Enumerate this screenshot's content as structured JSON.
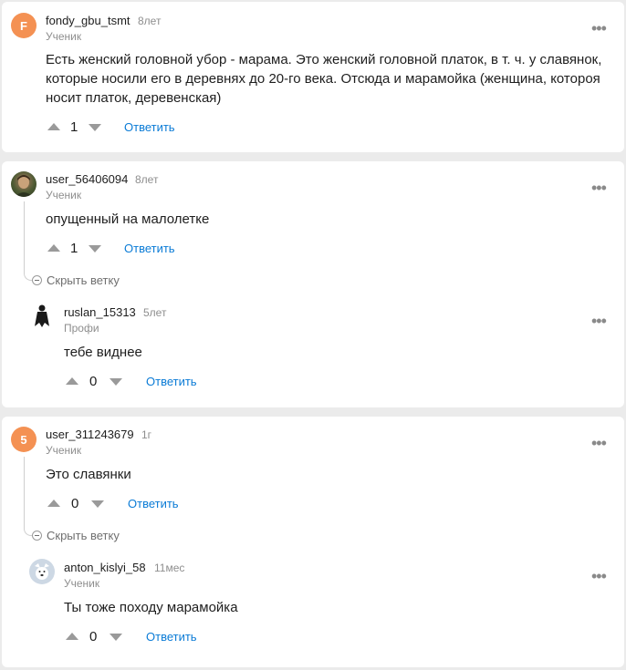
{
  "comments": [
    {
      "avatar_letter": "F",
      "username": "fondy_gbu_tsmt",
      "age": "8лет",
      "role": "Ученик",
      "lines": [
        "Есть женский головной убор - марама. Это женский головной платок, в т. ч. у славянок,",
        "которые носили его в деревнях до 20-го века. Отсюда и марамойка (женщина, котороя",
        "носит платок, деревенская)"
      ],
      "votes": "1",
      "reply_label": "Ответить"
    },
    {
      "username": "user_56406094",
      "age": "8лет",
      "role": "Ученик",
      "text": "опущенный на малолетке",
      "votes": "1",
      "reply_label": "Ответить",
      "collapse_label": "Скрыть ветку",
      "reply": {
        "username": "ruslan_15313",
        "age": "5лет",
        "role": "Профи",
        "text": "тебе виднее",
        "votes": "0",
        "reply_label": "Ответить"
      }
    },
    {
      "avatar_letter": "5",
      "username": "user_311243679",
      "age": "1г",
      "role": "Ученик",
      "text": "Это славянки",
      "votes": "0",
      "reply_label": "Ответить",
      "collapse_label": "Скрыть ветку",
      "reply": {
        "username": "anton_kislyi_58",
        "age": "11мес",
        "role": "Ученик",
        "text": "Ты тоже походу марамойка",
        "votes": "0",
        "reply_label": "Ответить"
      }
    }
  ],
  "icons": {
    "more": "more-dots-icon",
    "upvote": "upvote-arrow-icon",
    "downvote": "downvote-arrow-icon",
    "collapse": "minus-circle-icon"
  },
  "colors": {
    "accent": "#0a7bd6",
    "avatar_orange": "#f49153",
    "muted": "#8e8e8e"
  }
}
